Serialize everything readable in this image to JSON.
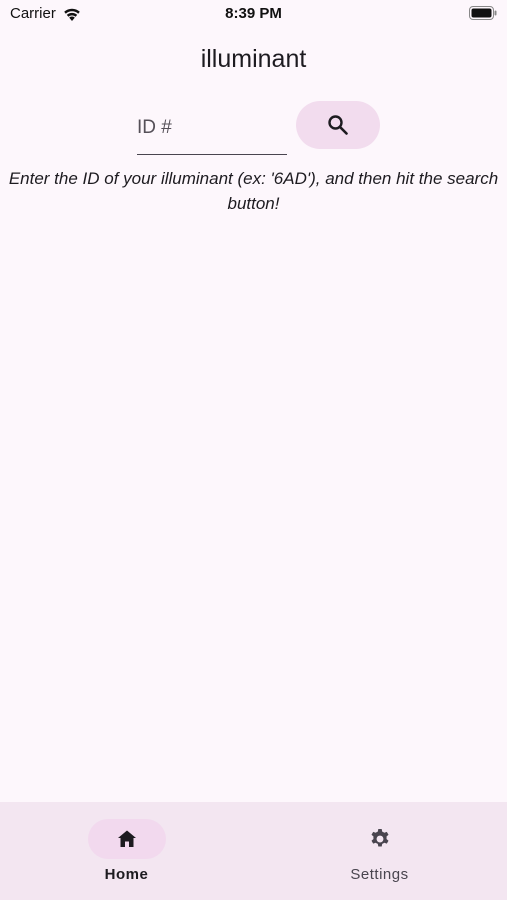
{
  "status_bar": {
    "carrier": "Carrier",
    "time": "8:39 PM"
  },
  "app": {
    "title": "illuminant"
  },
  "search": {
    "placeholder": "ID #",
    "value": "",
    "button_icon": "search-icon"
  },
  "instructions": {
    "text": "Enter the ID of your illuminant (ex: '6AD'), and then hit the search button!"
  },
  "bottom_nav": {
    "items": [
      {
        "label": "Home",
        "icon": "home-icon",
        "selected": true
      },
      {
        "label": "Settings",
        "icon": "gear-icon",
        "selected": false
      }
    ]
  },
  "colors": {
    "background": "#fdf7fc",
    "accent_container": "#f2dcee",
    "nav_background": "#f3e6f1",
    "on_surface": "#1d1b20"
  }
}
